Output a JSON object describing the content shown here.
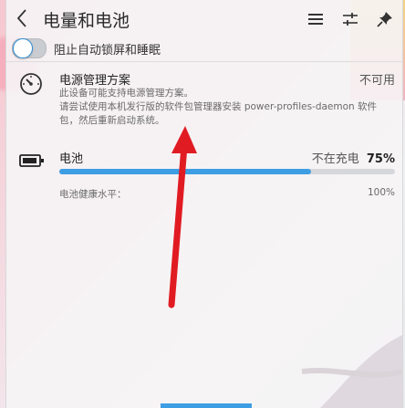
{
  "header": {
    "title": "电量和电池",
    "back_icon": "chevron-left-icon",
    "menu_icon": "hamburger-icon",
    "config_icon": "sliders-icon",
    "pin_icon": "pin-icon"
  },
  "inhibit": {
    "label": "阻止自动锁屏和睡眠",
    "checked": false
  },
  "power_profile": {
    "icon": "speedometer-icon",
    "title": "电源管理方案",
    "status": "不可用",
    "note_line1": "此设备可能支持电源管理方案。",
    "note_line2": "请尝试使用本机发行版的软件包管理器安装 power-profiles-daemon 软件",
    "note_line3": "包，然后重新启动系统。"
  },
  "battery": {
    "icon": "battery-icon",
    "title": "电池",
    "charge_state": "不在充电",
    "percent": "75%",
    "level": 0.75,
    "health_label": "电池健康水平：",
    "health_value": "100%"
  },
  "colors": {
    "accent": "#3d9ee3",
    "arrow": "#e11b22"
  }
}
